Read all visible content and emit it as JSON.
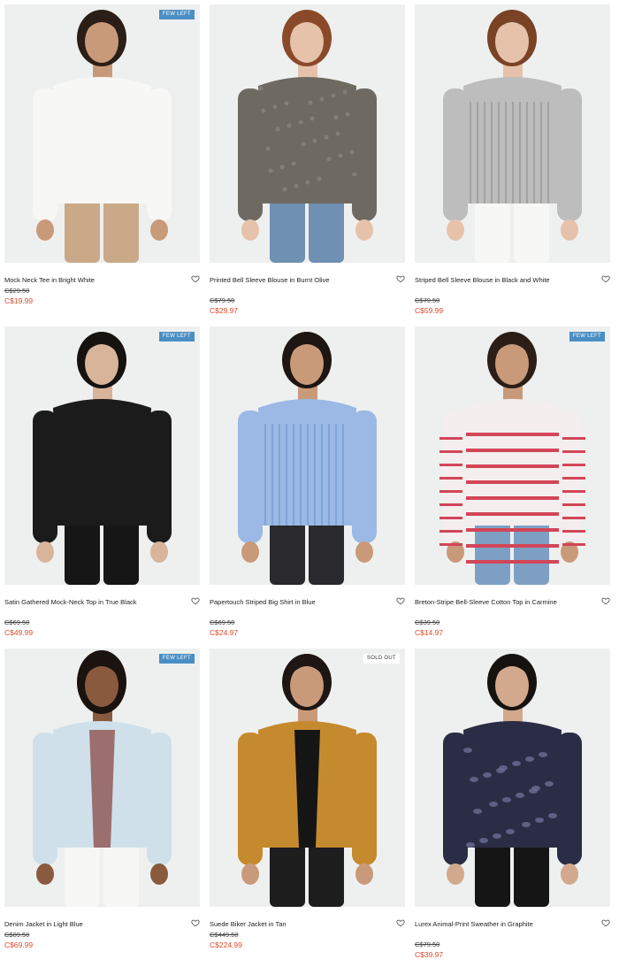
{
  "colors": {
    "sale_price": "#e24a2c",
    "few_left_badge": "#4a8fc4",
    "photo_background": "#eef0f0"
  },
  "products": [
    {
      "name": "Mock Neck Tee in Bright White",
      "original_price": "C$29.50",
      "sale_price": "C$19.99",
      "badge": "FEW LEFT",
      "favorite_icon": "heart-outline-icon",
      "garment_color": "#f7f7f5",
      "bottom_color": "#c9a988",
      "hair_color": "#2b1e17",
      "skin_color": "#c99a7a"
    },
    {
      "name": "Printed Bell Sleeve Blouse in Burnt Olive",
      "original_price": "C$79.50",
      "sale_price": "C$29.97",
      "badge": "",
      "favorite_icon": "heart-outline-icon",
      "garment_color": "#6e6a62",
      "bottom_color": "#6f8fb3",
      "hair_color": "#8a4a2a",
      "skin_color": "#e6c2ab"
    },
    {
      "name": "Striped Bell Sleeve Blouse in Black and White",
      "original_price": "C$79.50",
      "sale_price": "C$59.99",
      "badge": "",
      "favorite_icon": "heart-outline-icon",
      "garment_color": "#bdbdbd",
      "bottom_color": "#f7f7f5",
      "hair_color": "#7a4326",
      "skin_color": "#e6c2ab"
    },
    {
      "name": "Satin Gathered Mock-Neck Top in True Black",
      "original_price": "C$69.50",
      "sale_price": "C$49.99",
      "badge": "FEW LEFT",
      "favorite_icon": "heart-outline-icon",
      "garment_color": "#1b1b1b",
      "bottom_color": "#161616",
      "hair_color": "#161210",
      "skin_color": "#d8b49a"
    },
    {
      "name": "Papertouch Striped Big Shirt in Blue",
      "original_price": "C$69.50",
      "sale_price": "C$24.97",
      "badge": "",
      "favorite_icon": "heart-outline-icon",
      "garment_color": "#9bb9e4",
      "bottom_color": "#2a2a2e",
      "hair_color": "#1e1612",
      "skin_color": "#c99a7a"
    },
    {
      "name": "Breton-Stripe Bell-Sleeve Cotton Top in Carmine",
      "original_price": "C$39.50",
      "sale_price": "C$14.97",
      "badge": "FEW LEFT",
      "favorite_icon": "heart-outline-icon",
      "garment_color": "#f4eeee",
      "bottom_color": "#7d9fc4",
      "hair_color": "#2b1e17",
      "skin_color": "#c99a7a"
    },
    {
      "name": "Denim Jacket in Light Blue",
      "original_price": "C$89.50",
      "sale_price": "C$69.99",
      "badge": "FEW LEFT",
      "favorite_icon": "heart-outline-icon",
      "garment_color": "#cfe0ea",
      "bottom_color": "#f7f7f5",
      "hair_color": "#1b130f",
      "skin_color": "#8a5a3e"
    },
    {
      "name": "Suede Biker Jacket in Tan",
      "original_price": "C$449.50",
      "sale_price": "C$224.99",
      "badge": "SOLD OUT",
      "favorite_icon": "heart-outline-icon",
      "garment_color": "#c68a2e",
      "bottom_color": "#1d1d1d",
      "hair_color": "#1e1612",
      "skin_color": "#c99a7a"
    },
    {
      "name": "Lurex Animal-Print Sweather in Graphite",
      "original_price": "C$79.50",
      "sale_price": "C$39.97",
      "badge": "",
      "favorite_icon": "heart-outline-icon",
      "garment_color": "#2b2c45",
      "bottom_color": "#151515",
      "hair_color": "#161210",
      "skin_color": "#d2a98c"
    }
  ]
}
